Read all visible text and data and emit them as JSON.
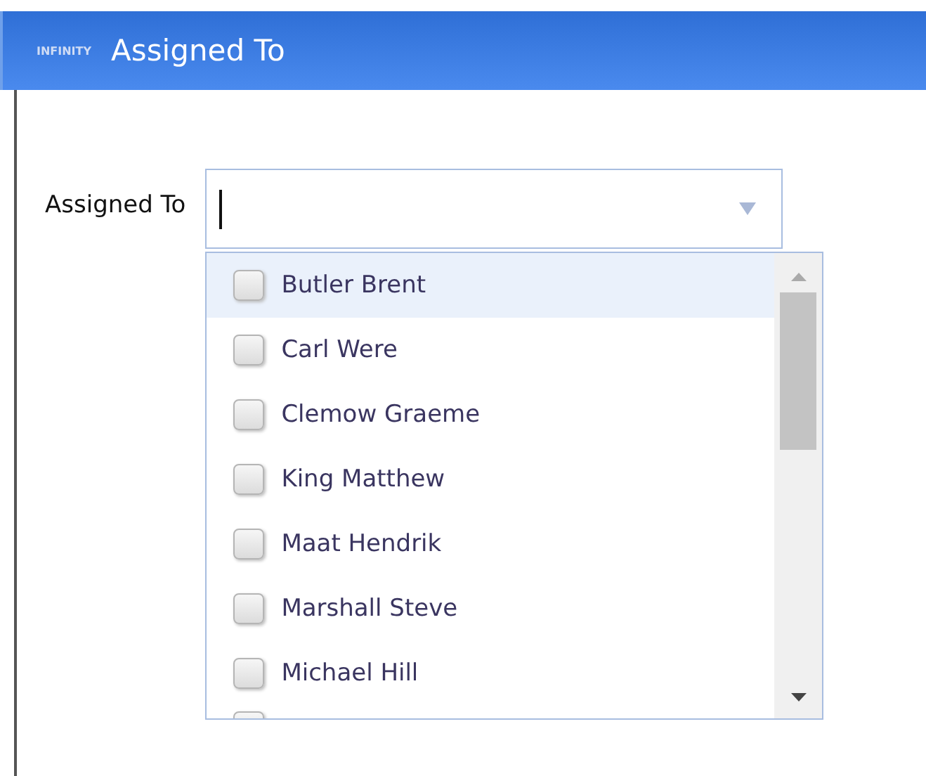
{
  "window": {
    "logo": "INFINITY",
    "title": "Assigned To"
  },
  "field": {
    "label": "Assigned To",
    "focused": true
  },
  "options": [
    {
      "name": "Butler Brent",
      "checked": false,
      "highlighted": true
    },
    {
      "name": "Carl Were",
      "checked": false,
      "highlighted": false
    },
    {
      "name": "Clemow Graeme",
      "checked": false,
      "highlighted": false
    },
    {
      "name": "King Matthew",
      "checked": false,
      "highlighted": false
    },
    {
      "name": "Maat Hendrik",
      "checked": false,
      "highlighted": false
    },
    {
      "name": "Marshall Steve",
      "checked": false,
      "highlighted": false
    },
    {
      "name": "Michael Hill",
      "checked": false,
      "highlighted": false
    }
  ],
  "cut_off_option": {
    "checked": false
  }
}
